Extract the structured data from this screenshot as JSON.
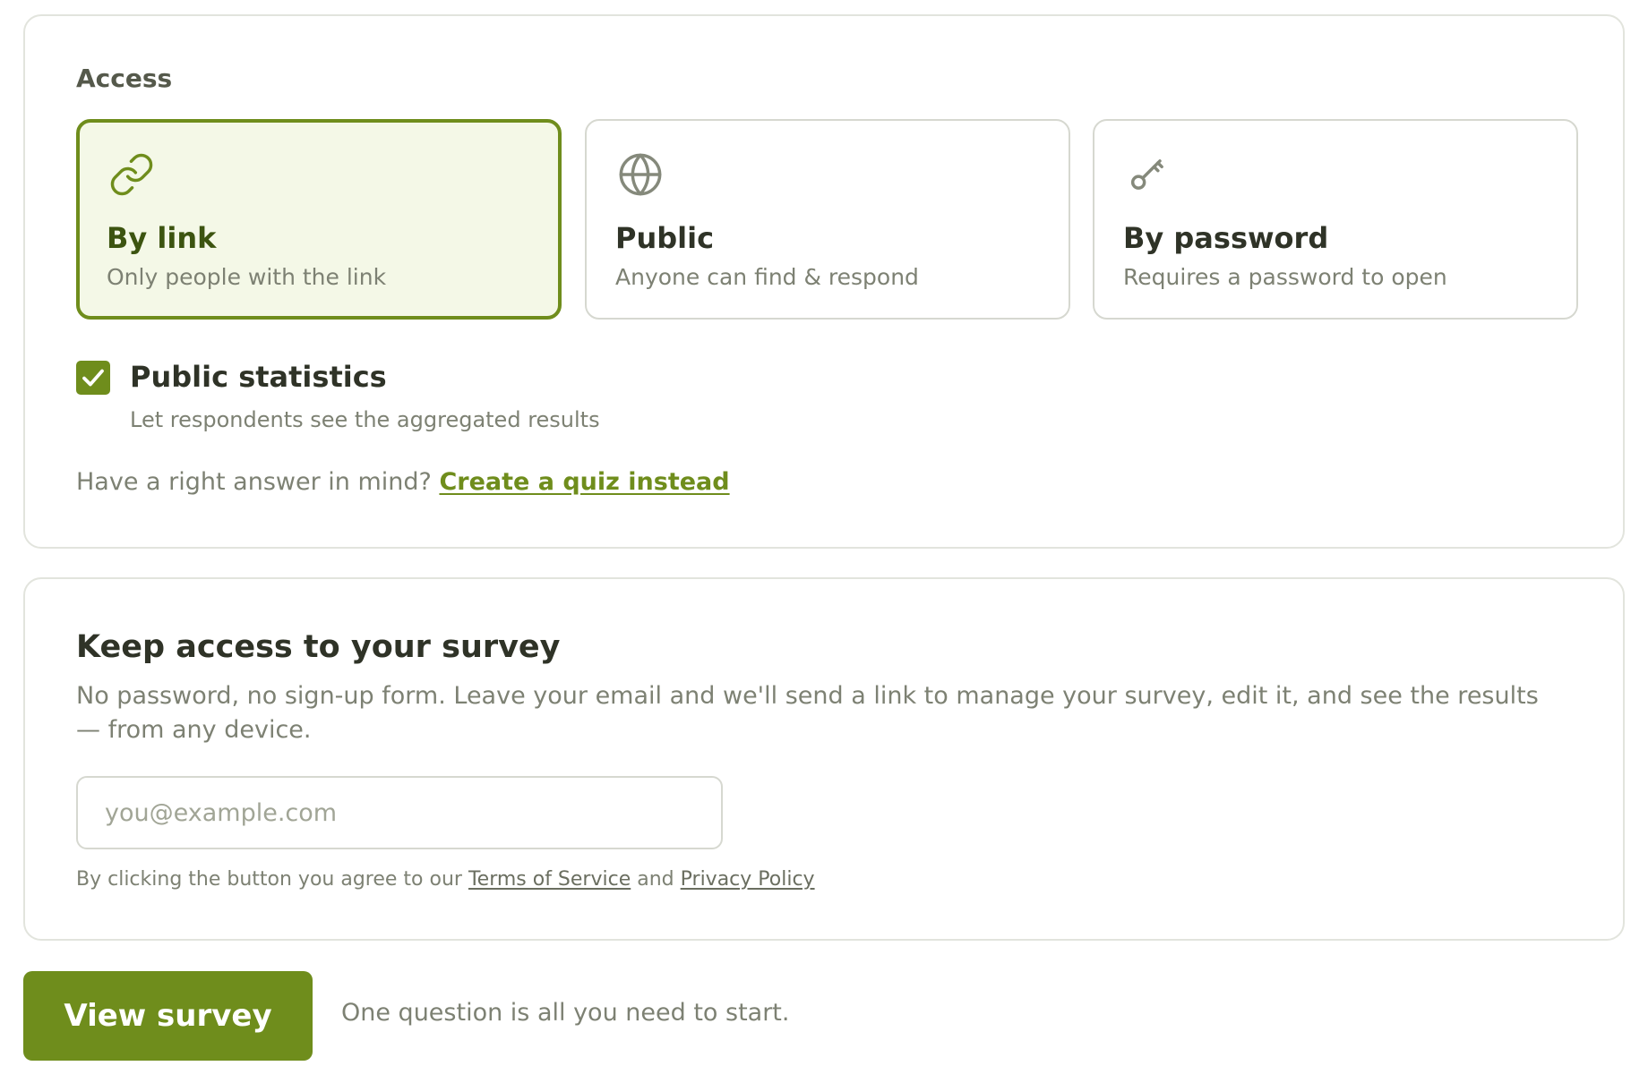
{
  "access": {
    "label": "Access",
    "options": [
      {
        "id": "by-link",
        "title": "By link",
        "description": "Only people with the link",
        "icon": "link-icon",
        "selected": true
      },
      {
        "id": "public",
        "title": "Public",
        "description": "Anyone can find & respond",
        "icon": "globe-icon",
        "selected": false
      },
      {
        "id": "by-password",
        "title": "By password",
        "description": "Requires a password to open",
        "icon": "key-icon",
        "selected": false
      }
    ],
    "public_statistics": {
      "label": "Public statistics",
      "description": "Let respondents see the aggregated results",
      "checked": true
    },
    "quiz_prompt": "Have a right answer in mind?",
    "quiz_link": "Create a quiz instead"
  },
  "keep_access": {
    "title": "Keep access to your survey",
    "description": "No password, no sign-up form. Leave your email and we'll send a link to manage your survey, edit it, and see the results — from any device.",
    "email": {
      "value": "",
      "placeholder": "you@example.com"
    },
    "terms": {
      "prefix": "By clicking the button you agree to our",
      "tos": "Terms of Service",
      "and": "and",
      "privacy": "Privacy Policy"
    }
  },
  "footer": {
    "button_label": "View survey",
    "hint": "One question is all you need to start."
  },
  "colors": {
    "accent": "#6f8d1c",
    "selected_bg": "#f4f8e7",
    "border": "#d6d8d0",
    "muted_text": "#7d8173"
  }
}
